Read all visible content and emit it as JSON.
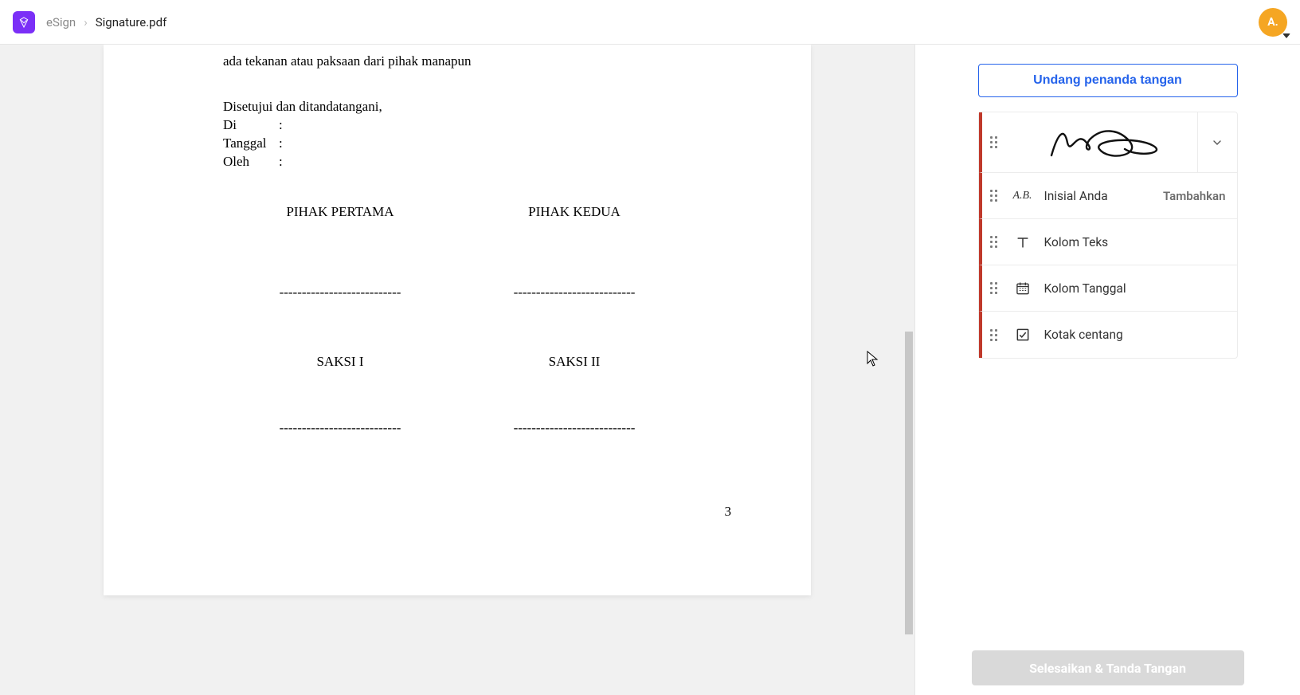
{
  "header": {
    "app_name": "eSign",
    "file_name": "Signature.pdf",
    "avatar_initial": "A."
  },
  "document": {
    "partial_top_line": "ada tekanan atau paksaan dari pihak manapun",
    "agree_line": "Disetujui dan ditandatangani,",
    "fields": {
      "di_label": "Di",
      "tanggal_label": "Tanggal",
      "oleh_label": "Oleh",
      "colon": ":"
    },
    "parties": {
      "first": "PIHAK PERTAMA",
      "second": "PIHAK KEDUA"
    },
    "dashes": "---------------------------",
    "witnesses": {
      "first": "SAKSI  I",
      "second": "SAKSI II"
    },
    "page_number": "3"
  },
  "sidebar": {
    "invite_label": "Undang penanda tangan",
    "tools": {
      "initials_label": "Inisial Anda",
      "initials_action": "Tambahkan",
      "initials_icon_text": "A.B.",
      "text_label": "Kolom Teks",
      "date_label": "Kolom Tanggal",
      "checkbox_label": "Kotak centang"
    },
    "finish_label": "Selesaikan & Tanda Tangan"
  },
  "colors": {
    "primary": "#2563eb",
    "tool_accent": "#c0392b",
    "avatar_bg": "#f5a623",
    "finish_disabled": "#d9d9d9"
  }
}
